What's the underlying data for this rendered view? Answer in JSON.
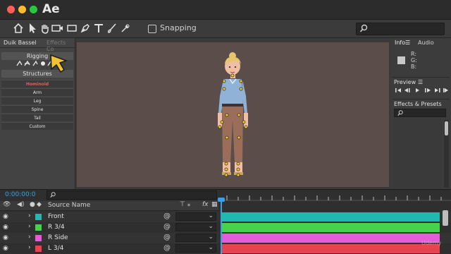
{
  "app": {
    "title": "Ae"
  },
  "toolbar": {
    "snapping_label": "Snapping",
    "search_icon": "search-icon"
  },
  "left_panel": {
    "tab_active": "Duik Bassel",
    "tab_inactive": "Effects Co",
    "rigging_header": "Rigging",
    "structures_header": "Structures",
    "items": [
      {
        "label": "Hominoid",
        "active": true
      },
      {
        "label": "Arm",
        "active": false
      },
      {
        "label": "Leg",
        "active": false
      },
      {
        "label": "Spine",
        "active": false
      },
      {
        "label": "Tail",
        "active": false
      },
      {
        "label": "Custom",
        "active": false
      }
    ]
  },
  "right_panel": {
    "info_tab": "Info",
    "audio_tab": "Audio",
    "rgb": [
      "R:",
      "G:",
      "B:"
    ],
    "preview_label": "Preview",
    "effects_label": "Effects & Presets"
  },
  "timeline": {
    "timecode": "0:00:00:0",
    "column_source_name": "Source Name",
    "layers": [
      {
        "name": "Front",
        "color": "#1fb9b0"
      },
      {
        "name": "R 3/4",
        "color": "#47d24c"
      },
      {
        "name": "R Side",
        "color": "#e65bd8"
      },
      {
        "name": "L 3/4",
        "color": "#e8444f"
      }
    ]
  },
  "watermark": "Udemy",
  "colors": {
    "accent_blue": "#3aa0e6",
    "hominoid_red": "#e95a5a",
    "cursor_yellow": "#f2c230"
  }
}
